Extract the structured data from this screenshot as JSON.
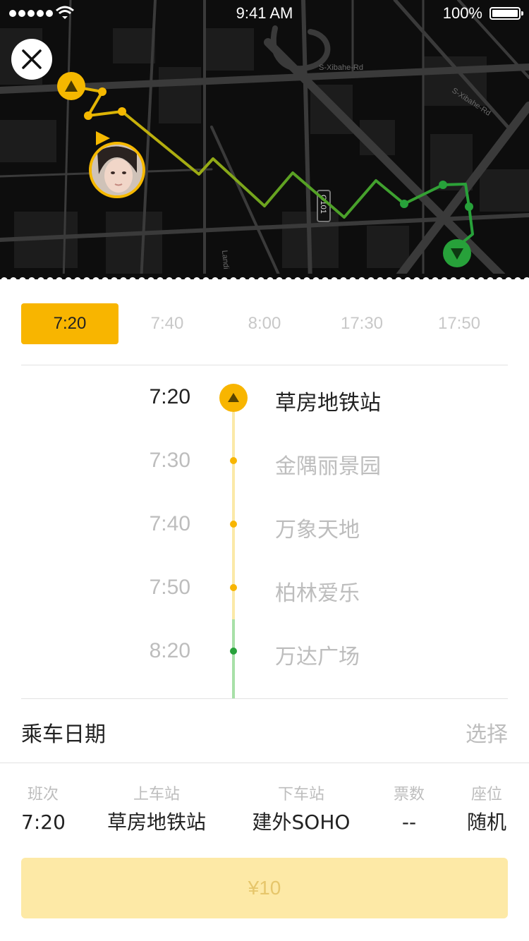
{
  "status_bar": {
    "time": "9:41 AM",
    "battery": "100%"
  },
  "map": {
    "road_labels": [
      "S-Xibahe-Rd",
      "S-Xibahe-Rd",
      "G101",
      "Landi"
    ]
  },
  "time_tabs": [
    {
      "label": "7:20",
      "active": true
    },
    {
      "label": "7:40",
      "active": false
    },
    {
      "label": "8:00",
      "active": false
    },
    {
      "label": "17:30",
      "active": false
    },
    {
      "label": "17:50",
      "active": false
    }
  ],
  "stops": [
    {
      "time": "7:20",
      "name": "草房地铁站"
    },
    {
      "time": "7:30",
      "name": "金隅丽景园"
    },
    {
      "time": "7:40",
      "name": "万象天地"
    },
    {
      "time": "7:50",
      "name": "柏林爱乐"
    },
    {
      "time": "8:20",
      "name": "万达广场"
    }
  ],
  "date_row": {
    "label": "乘车日期",
    "action": "选择"
  },
  "summary": {
    "headers": [
      "班次",
      "上车站",
      "下车站",
      "票数",
      "座位"
    ],
    "values": [
      "7:20",
      "草房地铁站",
      "建外SOHO",
      "--",
      "随机"
    ]
  },
  "pay_button": {
    "label": "¥10"
  },
  "colors": {
    "accent": "#f8b500",
    "route_green": "#27a13a",
    "map_bg": "#0d0d0d"
  }
}
